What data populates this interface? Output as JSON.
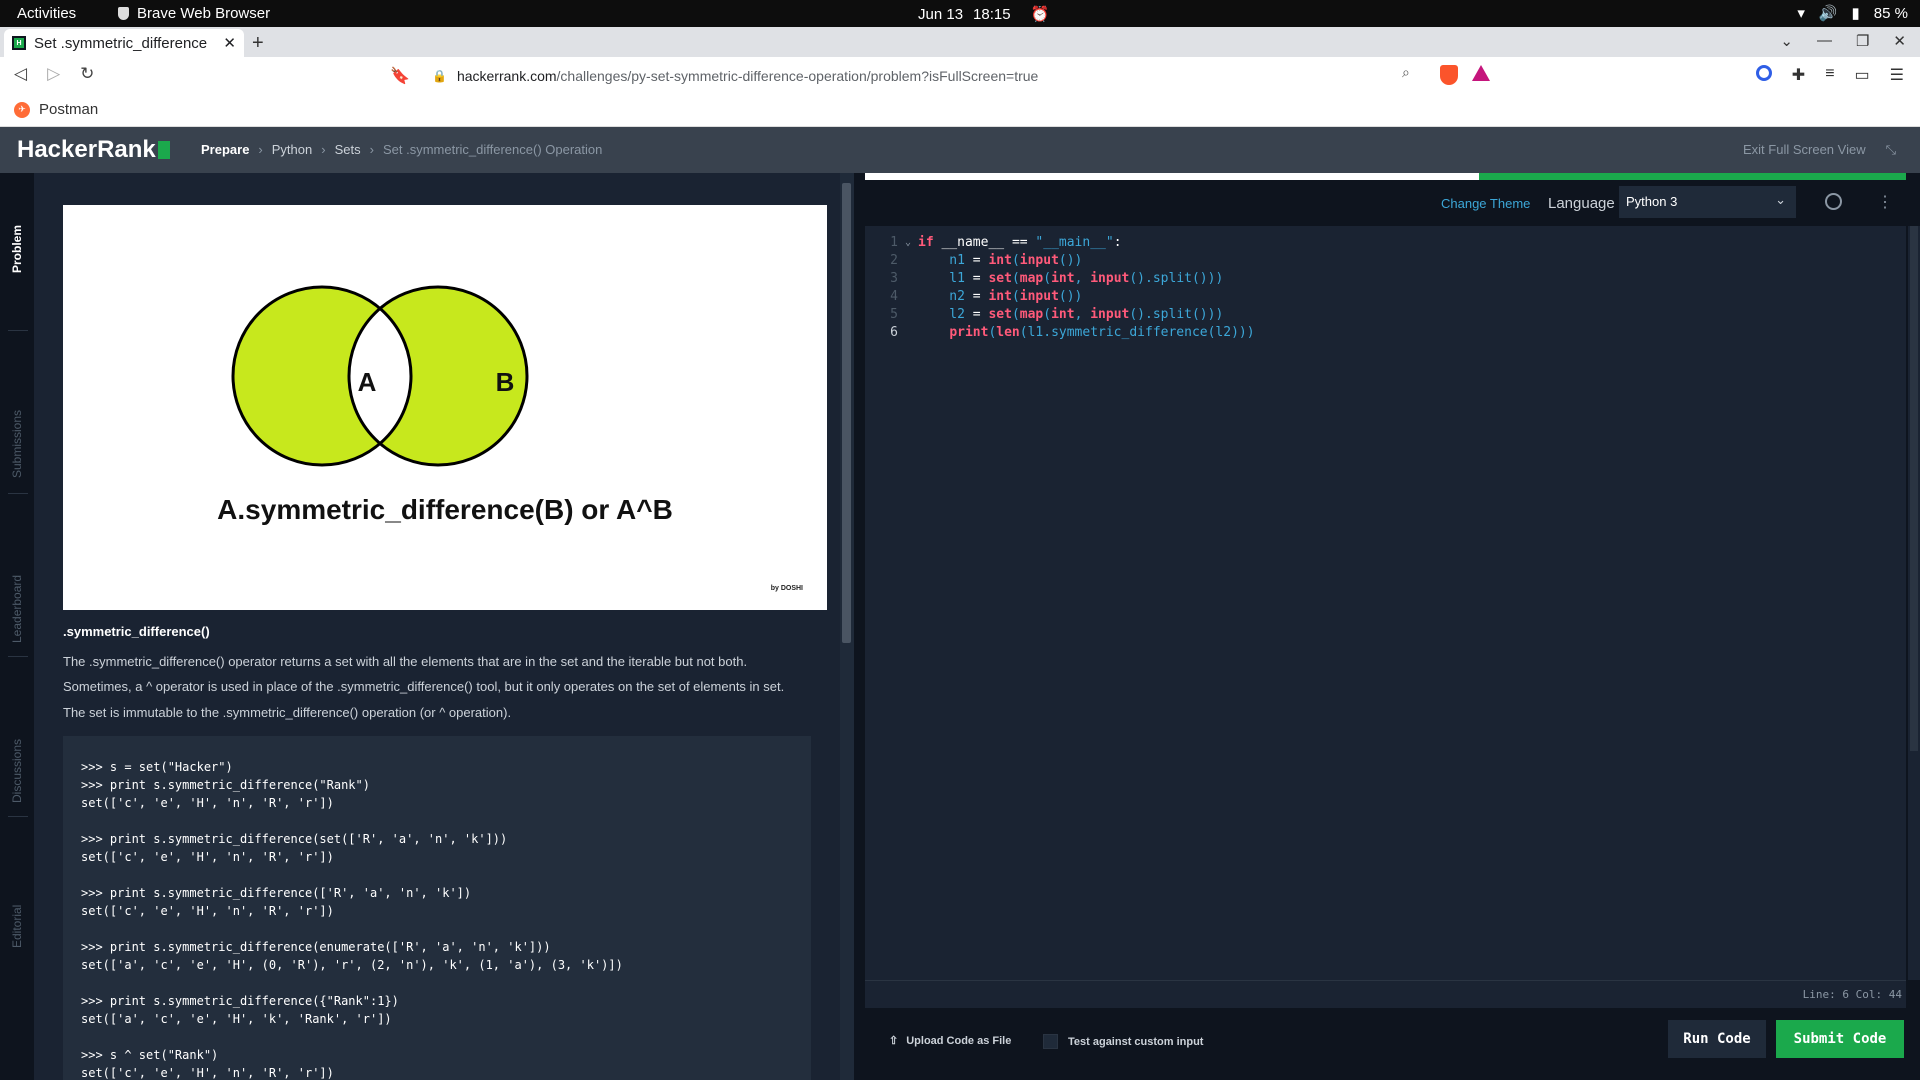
{
  "os": {
    "activities": "Activities",
    "app_name": "Brave Web Browser",
    "date": "Jun 13",
    "time": "18:15",
    "battery": "85 %"
  },
  "browser": {
    "tab_title": "Set .symmetric_difference",
    "url_host": "hackerrank.com",
    "url_path": "/challenges/py-set-symmetric-difference-operation/problem?isFullScreen=true",
    "bookmark": "Postman"
  },
  "header": {
    "logo": "HackerRank",
    "breadcrumbs": [
      "Prepare",
      "Python",
      "Sets",
      "Set .symmetric_difference() Operation"
    ],
    "exit_fullscreen": "Exit Full Screen View"
  },
  "sidebar": {
    "tabs": [
      "Problem",
      "Submissions",
      "Leaderboard",
      "Discussions",
      "Editorial"
    ]
  },
  "problem": {
    "venn": {
      "label_a": "A",
      "label_b": "B",
      "caption": "A.symmetric_difference(B) or A^B",
      "by": "by DOSHI",
      "fill_color": "#c7e81d"
    },
    "heading": ".symmetric_difference()",
    "paragraphs": [
      "The .symmetric_difference() operator returns a set with all the elements that are in the set and the iterable but not both.",
      "Sometimes, a ^ operator is used in place of the .symmetric_difference() tool, but it only operates on the set of elements in set.",
      "The set is immutable to the .symmetric_difference() operation (or ^ operation)."
    ],
    "code_example": ">>> s = set(\"Hacker\")\n>>> print s.symmetric_difference(\"Rank\")\nset(['c', 'e', 'H', 'n', 'R', 'r'])\n\n>>> print s.symmetric_difference(set(['R', 'a', 'n', 'k']))\nset(['c', 'e', 'H', 'n', 'R', 'r'])\n\n>>> print s.symmetric_difference(['R', 'a', 'n', 'k'])\nset(['c', 'e', 'H', 'n', 'R', 'r'])\n\n>>> print s.symmetric_difference(enumerate(['R', 'a', 'n', 'k']))\nset(['a', 'c', 'e', 'H', (0, 'R'), 'r', (2, 'n'), 'k', (1, 'a'), (3, 'k')])\n\n>>> print s.symmetric_difference({\"Rank\":1})\nset(['a', 'c', 'e', 'H', 'k', 'Rank', 'r'])\n\n>>> s ^ set(\"Rank\")\nset(['c', 'e', 'H', 'n', 'R', 'r'])"
  },
  "editor": {
    "change_theme": "Change Theme",
    "language_label": "Language",
    "language_value": "Python 3",
    "progress_fraction": 0.59,
    "line_numbers": [
      "1",
      "2",
      "3",
      "4",
      "5",
      "6"
    ],
    "status": "Line: 6 Col: 44",
    "upload": "Upload Code as File",
    "custom_input": "Test against custom input",
    "run": "Run Code",
    "submit": "Submit Code"
  }
}
